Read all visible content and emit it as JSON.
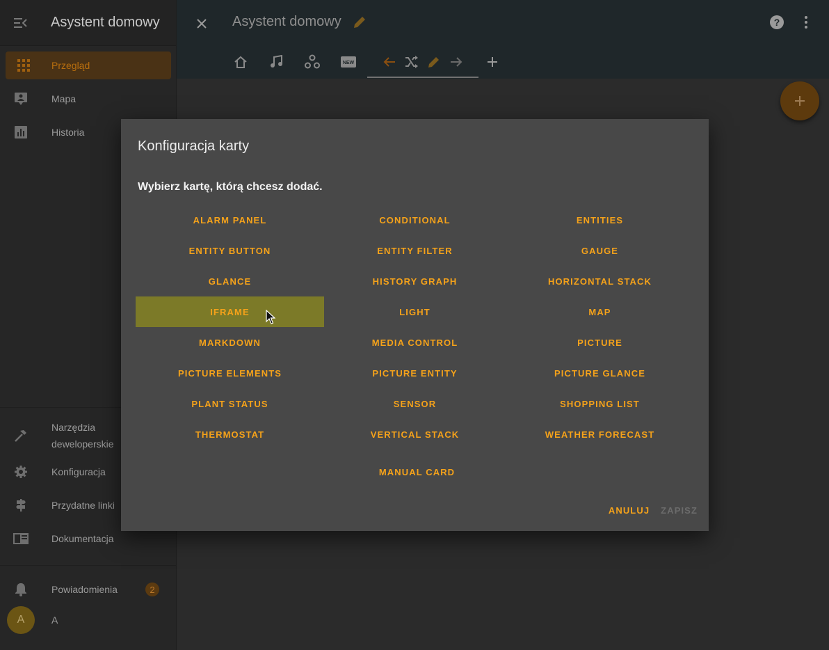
{
  "sidebar": {
    "title": "Asystent domowy",
    "items": [
      {
        "label": "Przegląd",
        "icon": "grid-icon",
        "active": true
      },
      {
        "label": "Mapa",
        "icon": "map-account-icon"
      },
      {
        "label": "Historia",
        "icon": "chart-icon"
      }
    ],
    "bottom_items": [
      {
        "label": "Narzędzia deweloperskie",
        "icon": "hammer-icon"
      },
      {
        "label": "Konfiguracja",
        "icon": "gear-icon"
      },
      {
        "label": "Przydatne linki",
        "icon": "signpost-icon"
      },
      {
        "label": "Dokumentacja",
        "icon": "book-icon"
      }
    ],
    "notifications": {
      "label": "Powiadomienia",
      "count": "2",
      "icon": "bell-icon"
    },
    "user": {
      "initial": "A",
      "name": "A"
    }
  },
  "header": {
    "title": "Asystent domowy",
    "tabs": [
      {
        "icon": "home-icon"
      },
      {
        "icon": "music-note-icon"
      },
      {
        "icon": "hub-icon"
      },
      {
        "icon": "new-box-icon"
      },
      {
        "icon": "arrow-left-icon"
      },
      {
        "icon": "shuffle-icon"
      },
      {
        "icon": "pencil-icon"
      },
      {
        "icon": "arrow-right-icon"
      },
      {
        "icon": "plus-icon"
      }
    ]
  },
  "dialog": {
    "title": "Konfiguracja karty",
    "subtitle": "Wybierz kartę, którą chcesz dodać.",
    "cards": [
      "ALARM PANEL",
      "CONDITIONAL",
      "ENTITIES",
      "ENTITY BUTTON",
      "ENTITY FILTER",
      "GAUGE",
      "GLANCE",
      "HISTORY GRAPH",
      "HORIZONTAL STACK",
      "IFRAME",
      "LIGHT",
      "MAP",
      "MARKDOWN",
      "MEDIA CONTROL",
      "PICTURE",
      "PICTURE ELEMENTS",
      "PICTURE ENTITY",
      "PICTURE GLANCE",
      "PLANT STATUS",
      "SENSOR",
      "SHOPPING LIST",
      "THERMOSTAT",
      "VERTICAL STACK",
      "WEATHER FORECAST"
    ],
    "hovered_card": "IFRAME",
    "manual_card": "MANUAL CARD",
    "cancel_label": "ANULUJ",
    "save_label": "ZAPISZ"
  },
  "colors": {
    "accent": "#f5a21a",
    "highlight": "#7c7a28",
    "dialog_bg": "#484848"
  }
}
